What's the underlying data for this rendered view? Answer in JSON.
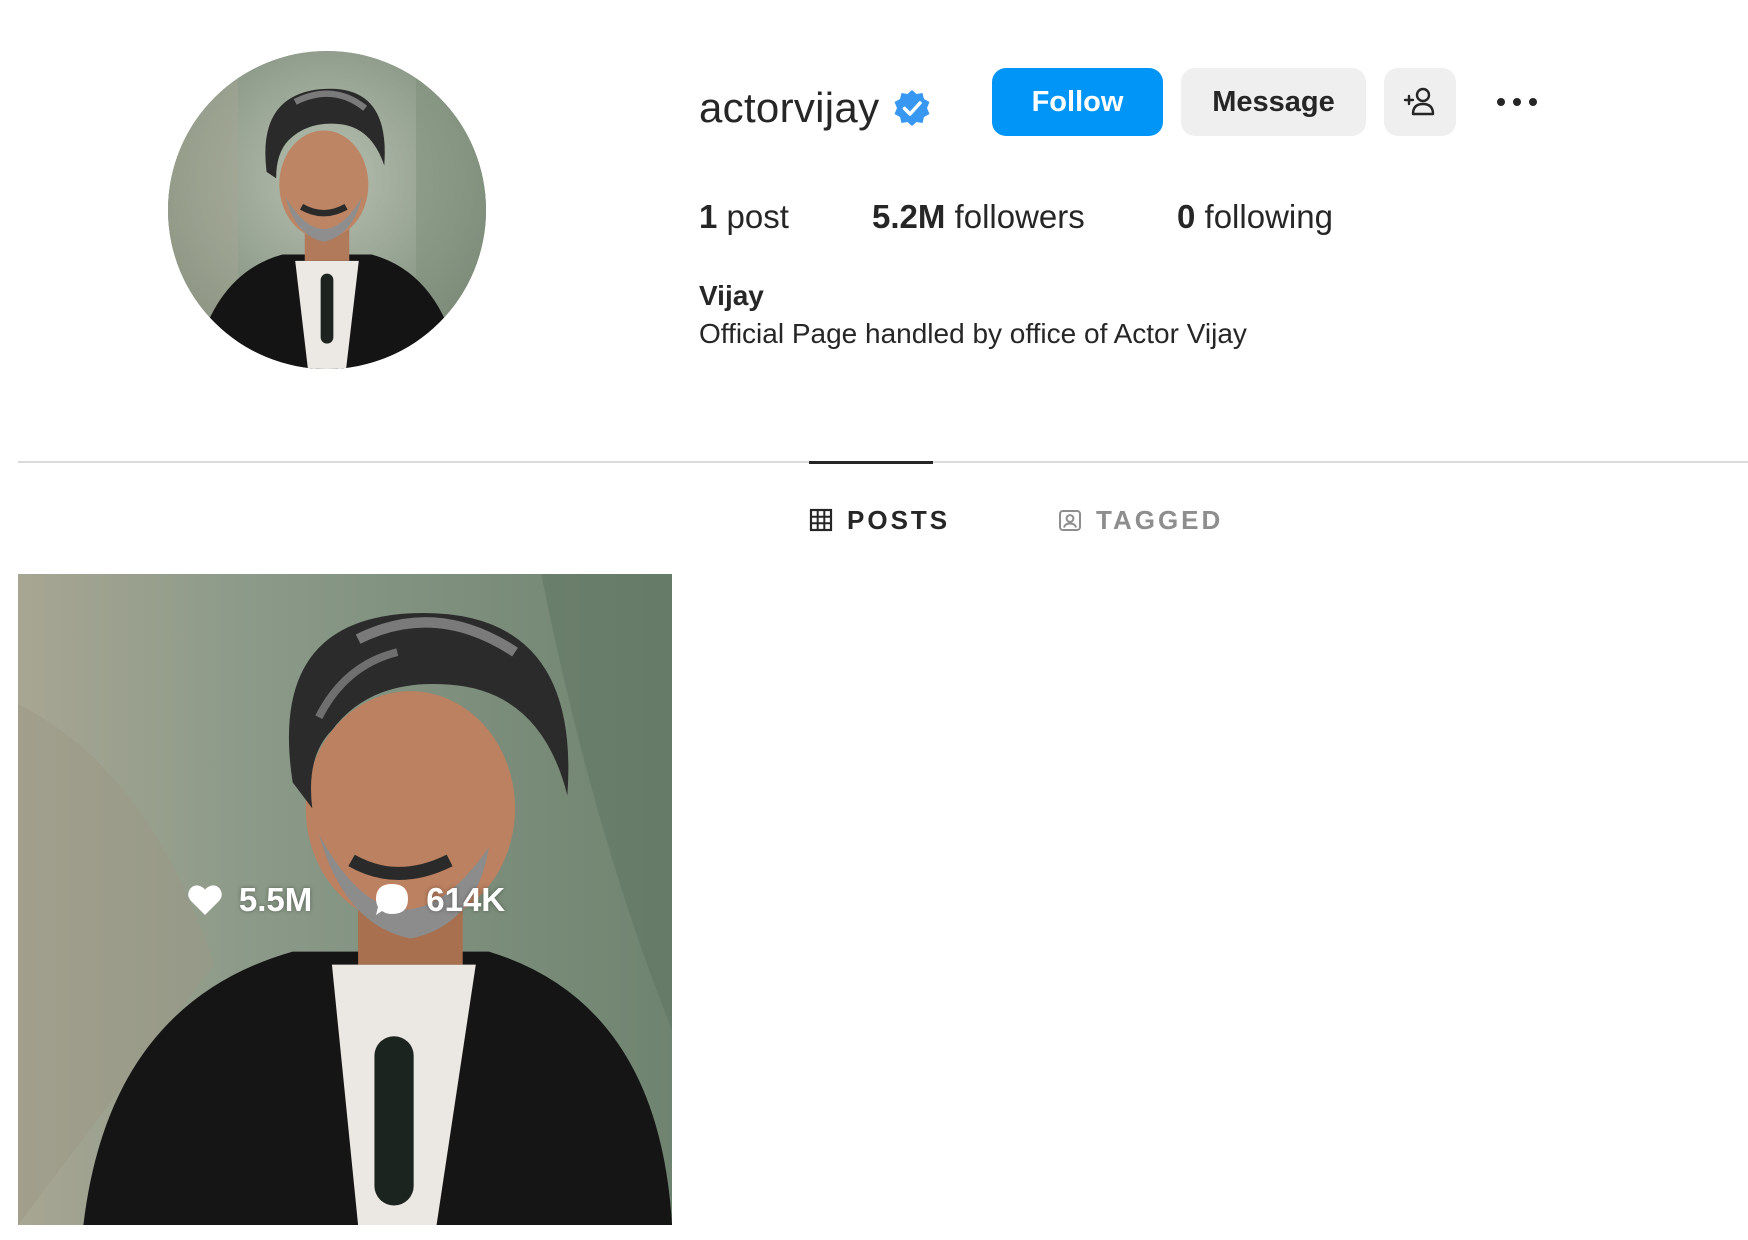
{
  "profile": {
    "username": "actorvijay",
    "verified": true,
    "full_name": "Vijay",
    "bio": "Official Page handled by office of Actor Vijay",
    "avatar_icon": "profile-photo"
  },
  "actions": {
    "follow_label": "Follow",
    "message_label": "Message",
    "suggest_icon": "add-person-icon",
    "more_icon": "more-options-icon"
  },
  "stats": {
    "posts_count": "1",
    "posts_label": "post",
    "followers_count": "5.2M",
    "followers_label": "followers",
    "following_count": "0",
    "following_label": "following"
  },
  "tabs": [
    {
      "label": "POSTS",
      "icon": "grid-icon",
      "active": true
    },
    {
      "label": "TAGGED",
      "icon": "tagged-icon",
      "active": false
    }
  ],
  "posts": [
    {
      "likes": "5.5M",
      "comments": "614K"
    }
  ],
  "colors": {
    "accent": "#0095f6",
    "verified": "#3897f0",
    "button_secondary": "#efefef",
    "text_primary": "#262626",
    "text_muted": "#8e8e8e",
    "divider": "#dbdbdb"
  }
}
